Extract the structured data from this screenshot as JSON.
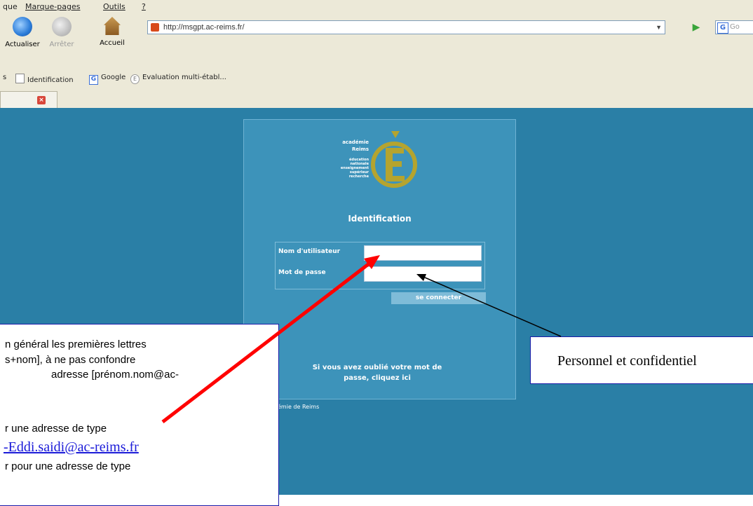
{
  "menubar": {
    "items": [
      "que",
      "Marque-pages",
      "Outils",
      "?"
    ]
  },
  "navbar": {
    "refresh_label": "Actualiser",
    "stop_label": "Arrêter",
    "home_label": "Accueil",
    "url": "http://msgpt.ac-reims.fr/",
    "search_placeholder": "Go"
  },
  "bookmarks": {
    "items": [
      "s",
      "Identification",
      "Google",
      "Evaluation multi-établ..."
    ]
  },
  "login": {
    "title": "Identification",
    "logo_text": [
      "académie",
      "Reims",
      "éducation",
      "nationale",
      "enseignement",
      "supérieur",
      "recherche"
    ],
    "username_label": "Nom d'utilisateur",
    "password_label": "Mot de passe",
    "submit_label": "se connecter",
    "forgot_line1": "Si vous avez oublié votre mot de",
    "forgot_line2": "passe, cliquez ici",
    "footer": "émie de Reims"
  },
  "annotations": {
    "left_lines": [
      "n général les premières lettres",
      "s+nom], à ne pas confondre",
      "adresse [prénom.nom@ac-",
      "r une adresse de type",
      "-Eddi.saidi@ac-reims.fr",
      "r pour une adresse de type"
    ],
    "right_text": "Personnel et confidentiel",
    "colors": {
      "box_border": "#1a1aa8",
      "red_arrow": "#ff0000",
      "black_arrow": "#000000",
      "link": "#1a1ad8"
    }
  },
  "colors": {
    "chrome": "#ece9d8",
    "page_bg": "#2a7fa6",
    "panel_bg": "#3d93ba",
    "logo": "#b5a42e"
  }
}
